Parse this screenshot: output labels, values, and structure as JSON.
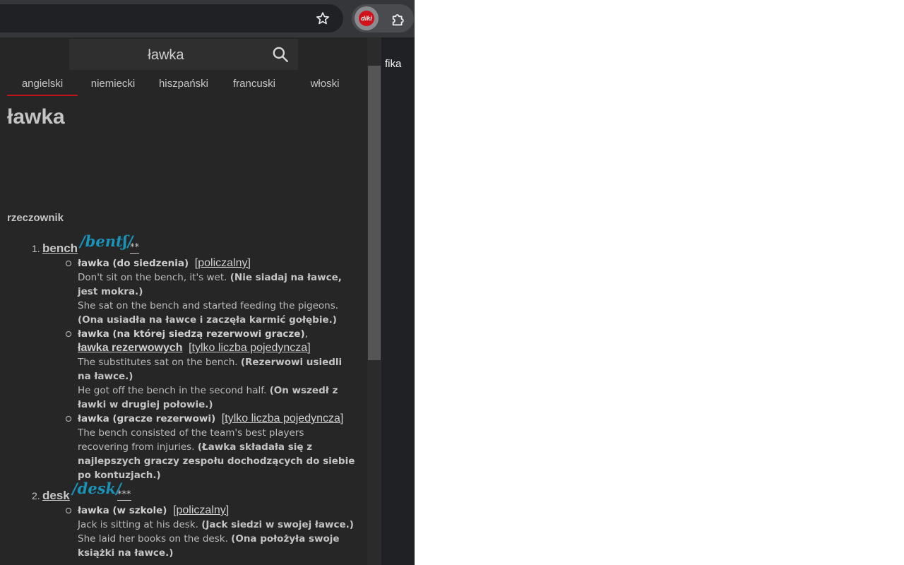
{
  "page": {
    "behind_text": "fika"
  },
  "search": {
    "value": "ławka"
  },
  "languages": [
    {
      "label": "angielski",
      "active": true
    },
    {
      "label": "niemiecki",
      "active": false
    },
    {
      "label": "hiszpański",
      "active": false
    },
    {
      "label": "francuski",
      "active": false
    },
    {
      "label": "włoski",
      "active": false
    }
  ],
  "entry": {
    "headword": "ławka",
    "pos": "rzeczownik",
    "senses": [
      {
        "num": "1.",
        "word": "bench",
        "pron": "/bentʃ/",
        "freq": "**",
        "meanings": [
          {
            "head": "ławka (do siedzenia)",
            "gram": "[policzalny]",
            "examples": [
              {
                "en": "Don't sit on the bench, it's wet.",
                "pl": "(Nie siadaj na ławce, jest mokra.)"
              },
              {
                "en": "She sat on the bench and started feeding the pigeons.",
                "pl": "(Ona usiadła na ławce i zaczęła karmić gołębie.)"
              }
            ]
          },
          {
            "head": "ławka (na której siedzą rezerwowi gracze)",
            "syn": "ławka rezerwowych",
            "gram": "[tylko liczba pojedyncza]",
            "examples": [
              {
                "en": "The substitutes sat on the bench.",
                "pl": "(Rezerwowi usiedli na ławce.)"
              },
              {
                "en": "He got off the bench in the second half.",
                "pl": "(On wszedł z ławki w drugiej połowie.)"
              }
            ]
          },
          {
            "head": "ławka (gracze rezerwowi)",
            "gram": "[tylko liczba pojedyncza]",
            "examples": [
              {
                "en": "The bench consisted of the team's best players recovering from injuries.",
                "pl": "(Ławka składała się z najlepszych graczy zespołu dochodzących do siebie po kontuzjach.)"
              }
            ]
          }
        ]
      },
      {
        "num": "2.",
        "word": "desk",
        "pron": "/desk/",
        "freq": "***",
        "meanings": [
          {
            "head": "ławka (w szkole)",
            "gram": "[policzalny]",
            "examples": [
              {
                "en": "Jack is sitting at his desk.",
                "pl": "(Jack siedzi w swojej ławce.)"
              },
              {
                "en": "She laid her books on the desk.",
                "pl": "(Ona położyła swoje książki na ławce.)"
              }
            ]
          }
        ]
      }
    ]
  },
  "colors": {
    "accent": "#c0121a",
    "pronunciation": "#1a93b8",
    "popup_bg": "#262626"
  },
  "icons": {
    "star": "star-icon",
    "extension": "diki-extension-icon",
    "puzzle": "puzzle-icon",
    "search": "search-icon"
  }
}
